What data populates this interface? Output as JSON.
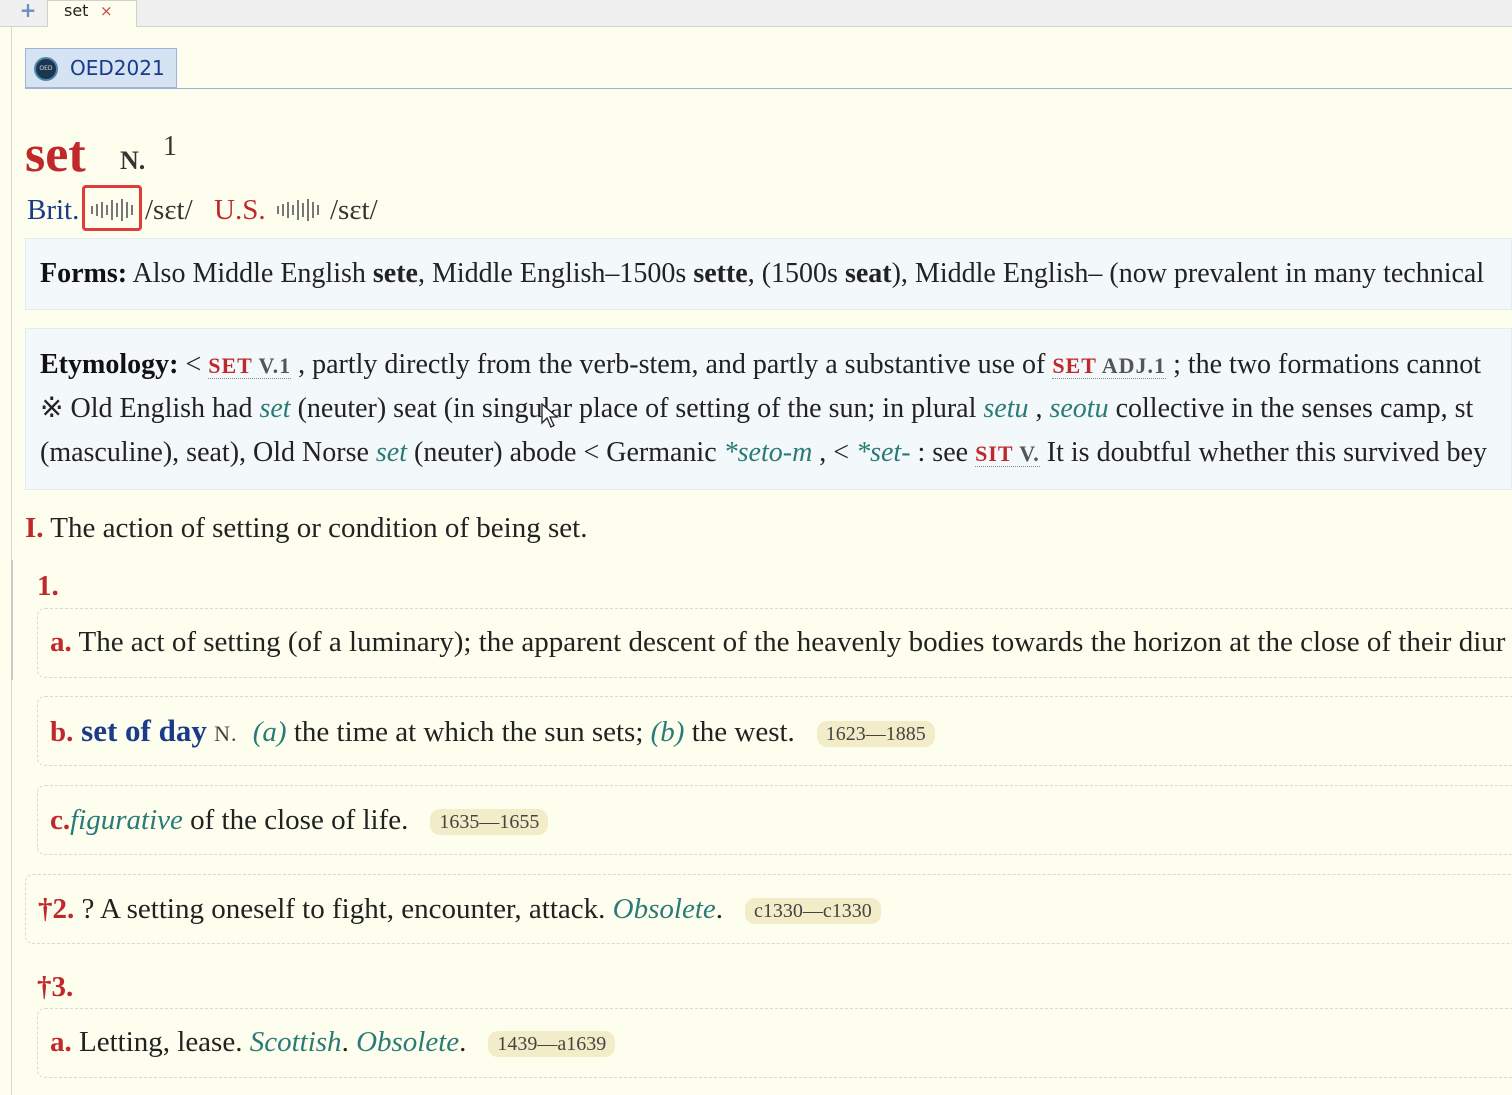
{
  "tabs": {
    "add_icon": "plus-icon",
    "active": {
      "title": "set",
      "close": "×"
    }
  },
  "dictionary": {
    "logo_text": "OED",
    "name": "OED2021"
  },
  "entry": {
    "headword": "set",
    "pos": "N.",
    "homograph": "1",
    "pron": {
      "brit_label": "Brit.",
      "brit_ipa": "/sɛt/",
      "us_label": "U.S.",
      "us_ipa": "/sɛt/"
    },
    "forms": {
      "label": "Forms:",
      "t1": "Also Middle English ",
      "b1": "sete",
      "t2": ", Middle English–1500s ",
      "b2": "sette",
      "t3": ", (1500s ",
      "b3": "seat",
      "t4": "), Middle English– (now prevalent in many technical"
    },
    "etymology": {
      "label": "Etymology:",
      "l1": {
        "t1": " < ",
        "x1": "SET",
        "x1sub": " V.1",
        "t2": " , partly directly from the verb-stem, and partly a substantive use of ",
        "x2": "SET",
        "x2sub": " ADJ.1",
        "t3": " ; the two formations cannot"
      },
      "l2": {
        "mark": "※",
        "t1": "  Old English had ",
        "i1": "set",
        "t2": " (neuter) seat (in singular place of setting of the sun; in plural ",
        "i2": "setu",
        "t3": " , ",
        "i3": "seotu",
        "t4": " collective in the senses camp, st"
      },
      "l3": {
        "t1": "(masculine), seat), Old Norse ",
        "i1": "set",
        "t2": " (neuter) abode < Germanic ",
        "i2": "*seto-m",
        "t3": " , < ",
        "i3": "*set-",
        "t4": " : see ",
        "x1": "SIT",
        "x1sub": " V.",
        "t5": "  It is doubtful whether this survived bey"
      }
    },
    "section": {
      "num": "I.",
      "text": " The action of setting or condition of being set."
    },
    "senses": {
      "s1": {
        "num": "1."
      },
      "s1a": {
        "num": "a.",
        "text": " The act of setting (of a luminary); the apparent descent of the heavenly bodies towards the horizon at the close of their diur"
      },
      "s1b": {
        "num": "b.",
        "phrase": " set of day",
        "pos": "N.",
        "a": "(a)",
        "t1": " the time at which the sun sets; ",
        "b": "(b)",
        "t2": " the west.",
        "dates": "1623—1885"
      },
      "s1c": {
        "num": "c.",
        "label": "figurative",
        "text": " of the close of life.",
        "dates": "1635—1655"
      },
      "s2": {
        "num": "†2.",
        "text": " ? A setting oneself to fight, encounter, attack. ",
        "label": "Obsolete",
        "tail": ".",
        "dates": "c1330—c1330"
      },
      "s3": {
        "num": "†3."
      },
      "s3a": {
        "num": "a.",
        "text": " Letting, lease. ",
        "label1": "Scottish",
        "sep": ". ",
        "label2": "Obsolete",
        "tail": ".",
        "dates": "1439—a1639"
      }
    }
  }
}
